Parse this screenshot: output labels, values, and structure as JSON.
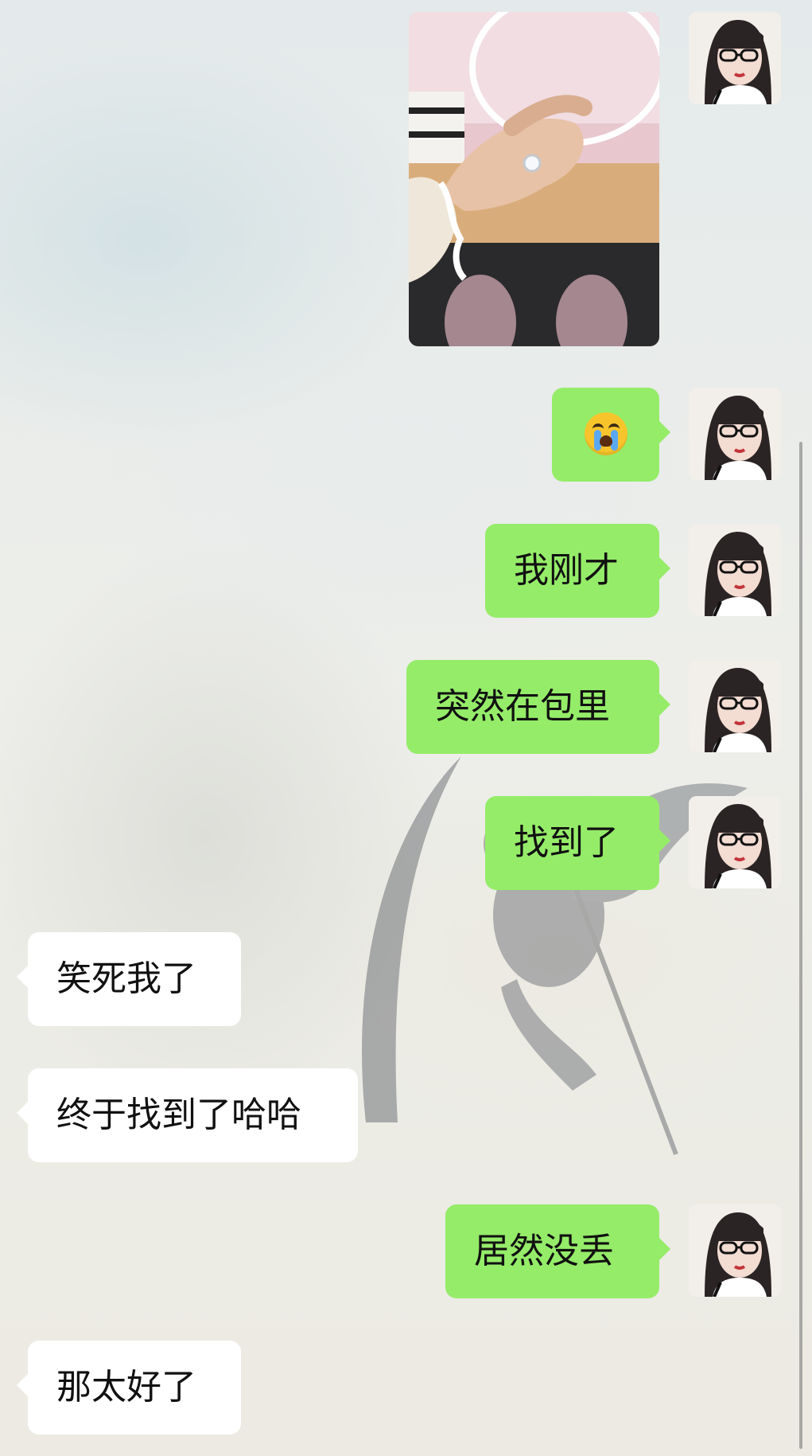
{
  "chat": {
    "messages": [
      {
        "id": "m1",
        "sender": "me",
        "type": "image",
        "alt": ""
      },
      {
        "id": "m2",
        "sender": "me",
        "type": "emoji",
        "emoji": "loudly-crying-face"
      },
      {
        "id": "m3",
        "sender": "me",
        "type": "text",
        "text": "我刚才"
      },
      {
        "id": "m4",
        "sender": "me",
        "type": "text",
        "text": "突然在包里"
      },
      {
        "id": "m5",
        "sender": "me",
        "type": "text",
        "text": "找到了"
      },
      {
        "id": "m6",
        "sender": "other",
        "type": "text",
        "text": "笑死我了"
      },
      {
        "id": "m7",
        "sender": "other",
        "type": "text",
        "text": "终于找到了哈哈"
      },
      {
        "id": "m8",
        "sender": "me",
        "type": "text",
        "text": "居然没丢"
      },
      {
        "id": "m9",
        "sender": "other",
        "type": "text",
        "text": "那太好了"
      }
    ]
  },
  "colors": {
    "my_bubble": "#95ec69",
    "other_bubble": "#ffffff",
    "text": "#111111"
  },
  "icons": {
    "emoji": "loudly-crying-face-icon",
    "avatar": "avatar-girl-with-glasses"
  }
}
